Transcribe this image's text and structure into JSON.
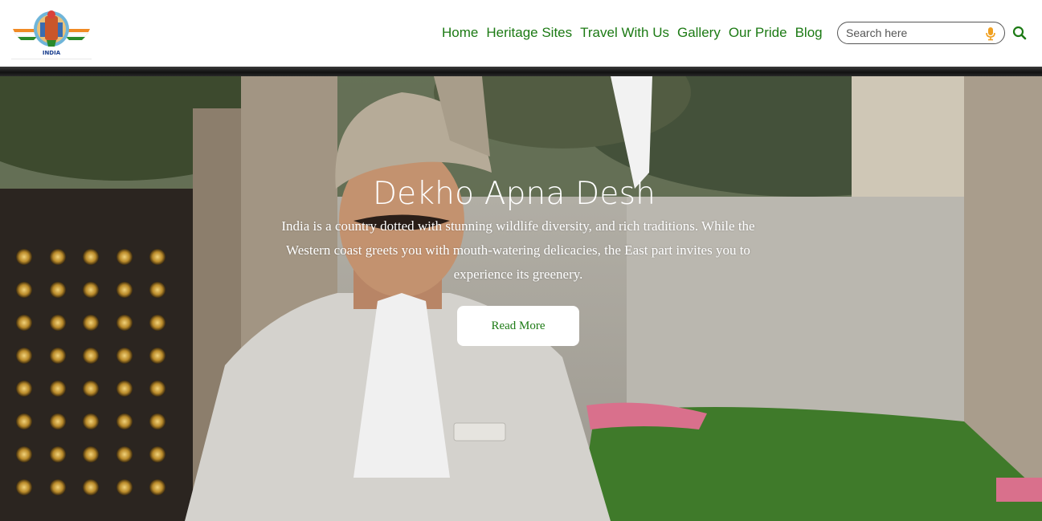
{
  "brand": {
    "logo_text": "INDIA"
  },
  "nav": {
    "items": [
      {
        "label": "Home"
      },
      {
        "label": "Heritage Sites"
      },
      {
        "label": "Travel With Us"
      },
      {
        "label": "Gallery"
      },
      {
        "label": "Our Pride"
      },
      {
        "label": "Blog"
      }
    ]
  },
  "search": {
    "placeholder": "Search here",
    "value": "",
    "mic_icon": "microphone-icon",
    "button_icon": "search-icon"
  },
  "hero": {
    "title": "Dekho Apna Desh",
    "description": "India is a country dotted with stunning wildlife diversity, and rich traditions. While the Western coast greets you with mouth-watering delicacies, the East part invites you to experience its greenery.",
    "cta_label": "Read More"
  },
  "colors": {
    "nav_green": "#1c7a14",
    "cta_text": "#1c7a14",
    "mic_orange": "#f0a020"
  }
}
